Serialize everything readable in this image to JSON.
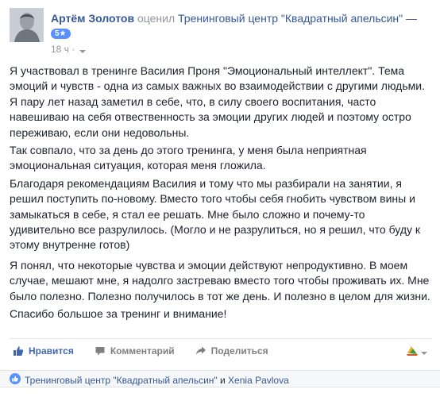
{
  "post": {
    "author": "Артём Золотов",
    "verb": "оценил",
    "page_name": "Тренинговый центр \"Квадратный апельсин\"",
    "dash": "—",
    "rating_badge": "5★",
    "time": "18 ч ·",
    "privacy_icon": "caret-down-icon",
    "paragraphs": [
      "Я участвовал в тренинге Василия Проня \"Эмоциональный интеллект\". Тема эмоций и чувств - одна из самых важных во взаимодействии с другими людьми. Я пару лет назад заметил в себе, что, в силу своего воспитания, часто навешиваю на себя отвественность за эмоции других людей и поэтому остро переживаю, если они недовольны.",
      "Так совпало, что за день до этого тренинга, у меня была неприятная эмоциональная ситуация, которая меня гложила.",
      "Благодаря рекомендациям Василия и тому что мы разбирали на занятии, я решил поступить по-новому. Вместо того чтобы себя гнобить чувством вины и замыкаться в себе, я стал ее решать. Мне было сложно и почему-то удивительно все разрулилось. (Могло и не разрулиться, но я решил, что буду к этому внутренне готов)",
      "Я понял, что некоторые чувства и эмоции действуют непродуктивно. В моем случае, мешают мне, я надолго застреваю вместо того чтобы проживать их. Мне было полезно. Полезно получилось в тот же день. И полезно в целом для жизни.",
      "Спасибо большое за тренинг и внимание!"
    ]
  },
  "actions": {
    "like": "Нравится",
    "comment": "Комментарий",
    "share": "Поделиться"
  },
  "likes": {
    "name1": "Тренинговый центр \"Квадратный апельсин\"",
    "and": "и",
    "name2": "Xenia Pavlova"
  },
  "colors": {
    "link": "#365899",
    "like_active": "#4267b2",
    "muted": "#90949c",
    "badge": "#5890ff"
  }
}
